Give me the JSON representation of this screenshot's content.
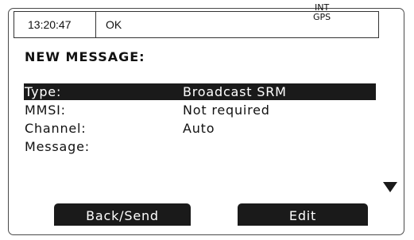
{
  "status_bar": {
    "time": "13:20:47",
    "status": "OK",
    "source_line1": "INT",
    "source_line2": "GPS"
  },
  "title": "NEW MESSAGE:",
  "fields": [
    {
      "label": "Type:",
      "value": "Broadcast SRM",
      "selected": true
    },
    {
      "label": "MMSI:",
      "value": "Not required",
      "selected": false
    },
    {
      "label": "Channel:",
      "value": "Auto",
      "selected": false
    },
    {
      "label": "Message:",
      "value": "",
      "selected": false
    }
  ],
  "scroll_indicator": "scroll-down-arrow-icon",
  "softkeys": {
    "left": "Back/Send",
    "right": "Edit"
  },
  "colors": {
    "highlight": "#1a1a1a",
    "background": "#ffffff",
    "text": "#111111"
  }
}
